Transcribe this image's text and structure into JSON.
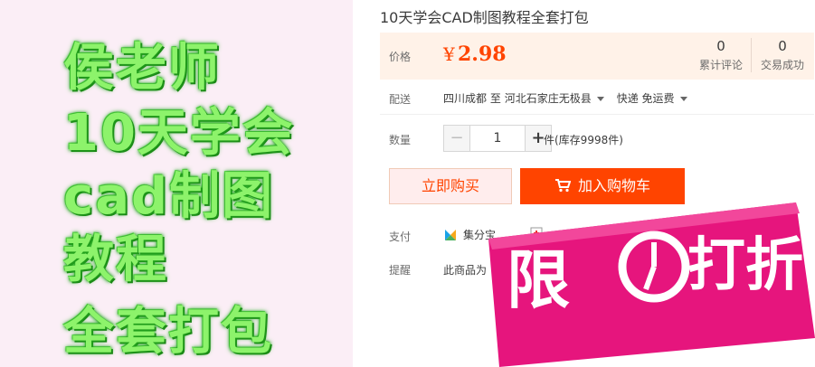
{
  "promo_image": {
    "lines": [
      "侯老师",
      "10天学会",
      "cad制图",
      "教程",
      "全套打包"
    ],
    "text_color": "#8df36b"
  },
  "product": {
    "title": "10天学会CAD制图教程全套打包",
    "price_label": "价格",
    "price_symbol": "¥",
    "price_value": "2.98",
    "stats": [
      {
        "count": "0",
        "label": "累计评论"
      },
      {
        "count": "0",
        "label": "交易成功"
      }
    ],
    "shipping": {
      "label": "配送",
      "origin": "四川成都",
      "to": "至",
      "destination": "河北石家庄无极县",
      "method": "快递 免运费"
    },
    "quantity": {
      "label": "数量",
      "minus": "−",
      "value": "1",
      "plus": "+",
      "stock": "件(库存9998件)"
    },
    "buttons": {
      "buy_now": "立即购买",
      "add_to_cart": "加入购物车"
    },
    "payment": {
      "label": "支付",
      "method_1": "集分宝"
    },
    "notice": {
      "label": "提醒",
      "text": "此商品为"
    }
  },
  "sticker": {
    "char_1": "限",
    "char_2": "打折",
    "background": "#e6157d"
  },
  "colors": {
    "accent": "#ff4400",
    "price_box_bg": "#fff2e8"
  }
}
